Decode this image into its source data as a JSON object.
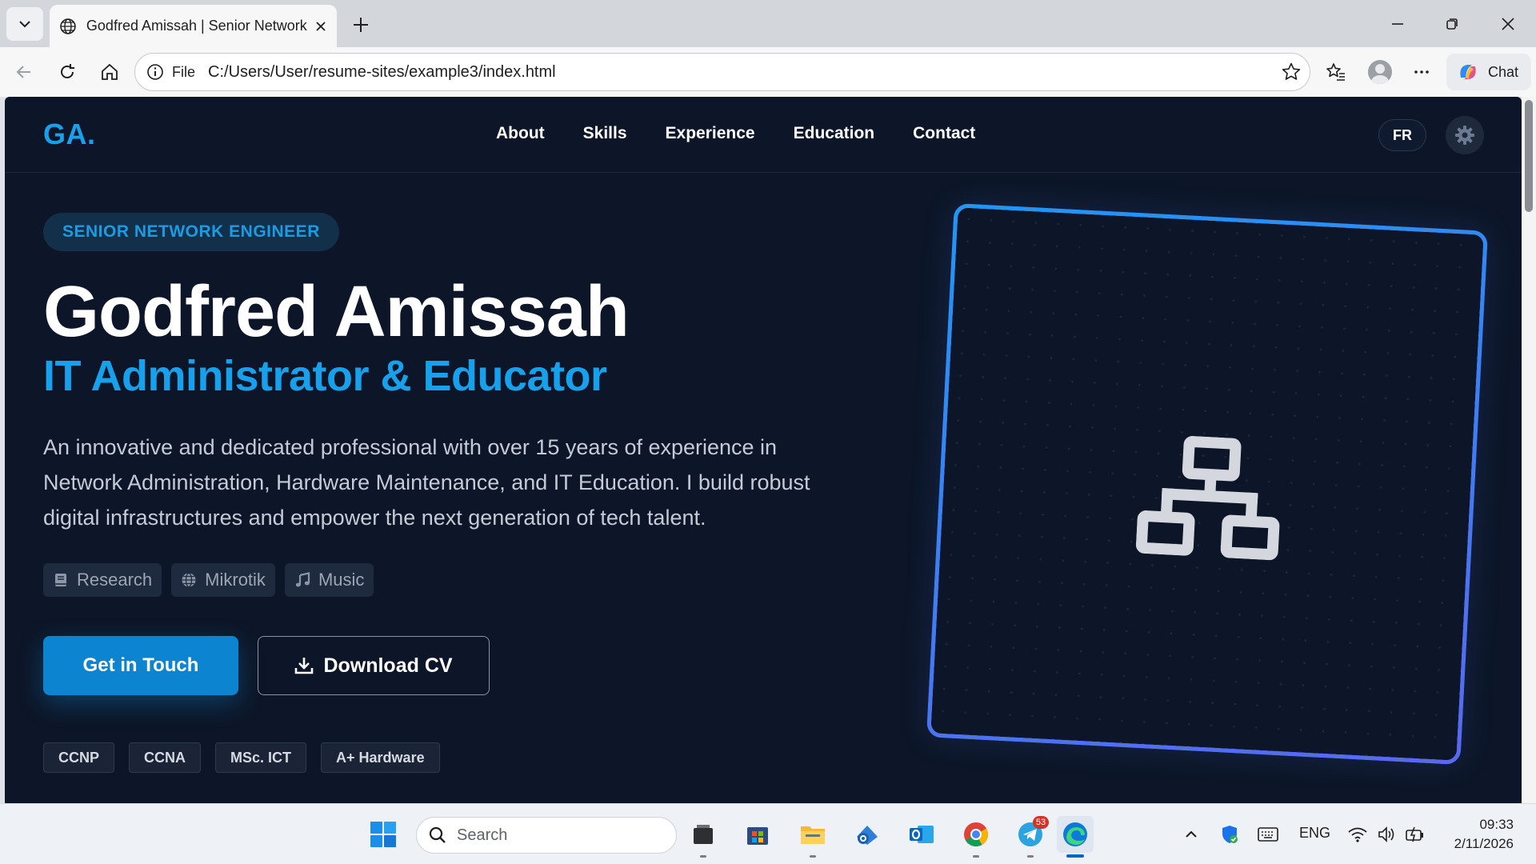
{
  "browser": {
    "tab_title": "Godfred Amissah | Senior Network Engineer",
    "url_scheme": "File",
    "url": "C:/Users/User/resume-sites/example3/index.html",
    "chat_label": "Chat"
  },
  "site": {
    "logo": "GA.",
    "nav": [
      "About",
      "Skills",
      "Experience",
      "Education",
      "Contact"
    ],
    "lang_toggle": "FR",
    "hero": {
      "badge": "SENIOR NETWORK ENGINEER",
      "name": "Godfred Amissah",
      "role": "IT Administrator & Educator",
      "bio": "An innovative and dedicated professional with over 15 years of experience in Network Administration, Hardware Maintenance, and IT Education. I build robust digital infrastructures and empower the next generation of tech talent.",
      "interests": [
        {
          "label": "Research",
          "icon": "book-icon"
        },
        {
          "label": "Mikrotik",
          "icon": "globe-icon"
        },
        {
          "label": "Music",
          "icon": "music-note-icon"
        }
      ],
      "cta_primary": "Get in Touch",
      "cta_secondary": "Download CV",
      "certifications": [
        "CCNP",
        "CCNA",
        "MSc. ICT",
        "A+ Hardware"
      ]
    },
    "colors": {
      "background": "#0d1628",
      "accent": "#17a1ec",
      "frame_gradient_start": "#2196f3",
      "frame_gradient_end": "#5b67f0"
    }
  },
  "taskbar": {
    "search_placeholder": "Search",
    "telegram_badge": "53",
    "language": "ENG",
    "time": "09:33",
    "date": "2/11/2026"
  }
}
